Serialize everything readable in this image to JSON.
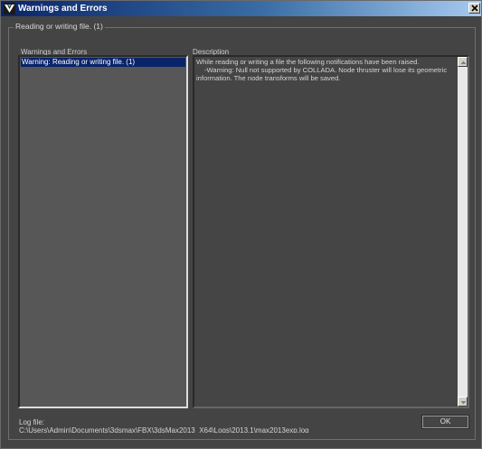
{
  "window": {
    "title": "Warnings and Errors",
    "app_icon": "3ds-max-logo-icon",
    "close_icon": "close-icon"
  },
  "group": {
    "title": "Reading or writing file. (1)"
  },
  "list": {
    "header": "Warnings and Errors",
    "items": [
      {
        "label": "Warning: Reading or writing file. (1)",
        "selected": true
      }
    ]
  },
  "description": {
    "header": "Description",
    "lines": [
      "While reading or writing a file the following notifications have been raised.",
      "-Warning: Null not supported by COLLADA. Node thruster will lose its geometric",
      "information. The node transforms will be saved."
    ]
  },
  "log": {
    "label": "Log file:",
    "path": "C:\\Users\\Admin\\Documents\\3dsmax\\FBX\\3dsMax2013_X64\\Logs\\2013.1\\max2013exp.log"
  },
  "buttons": {
    "ok": "OK"
  },
  "colors": {
    "titlebar_start": "#0a246a",
    "titlebar_end": "#a6caf0",
    "selection": "#0a246a",
    "background": "#444444"
  }
}
